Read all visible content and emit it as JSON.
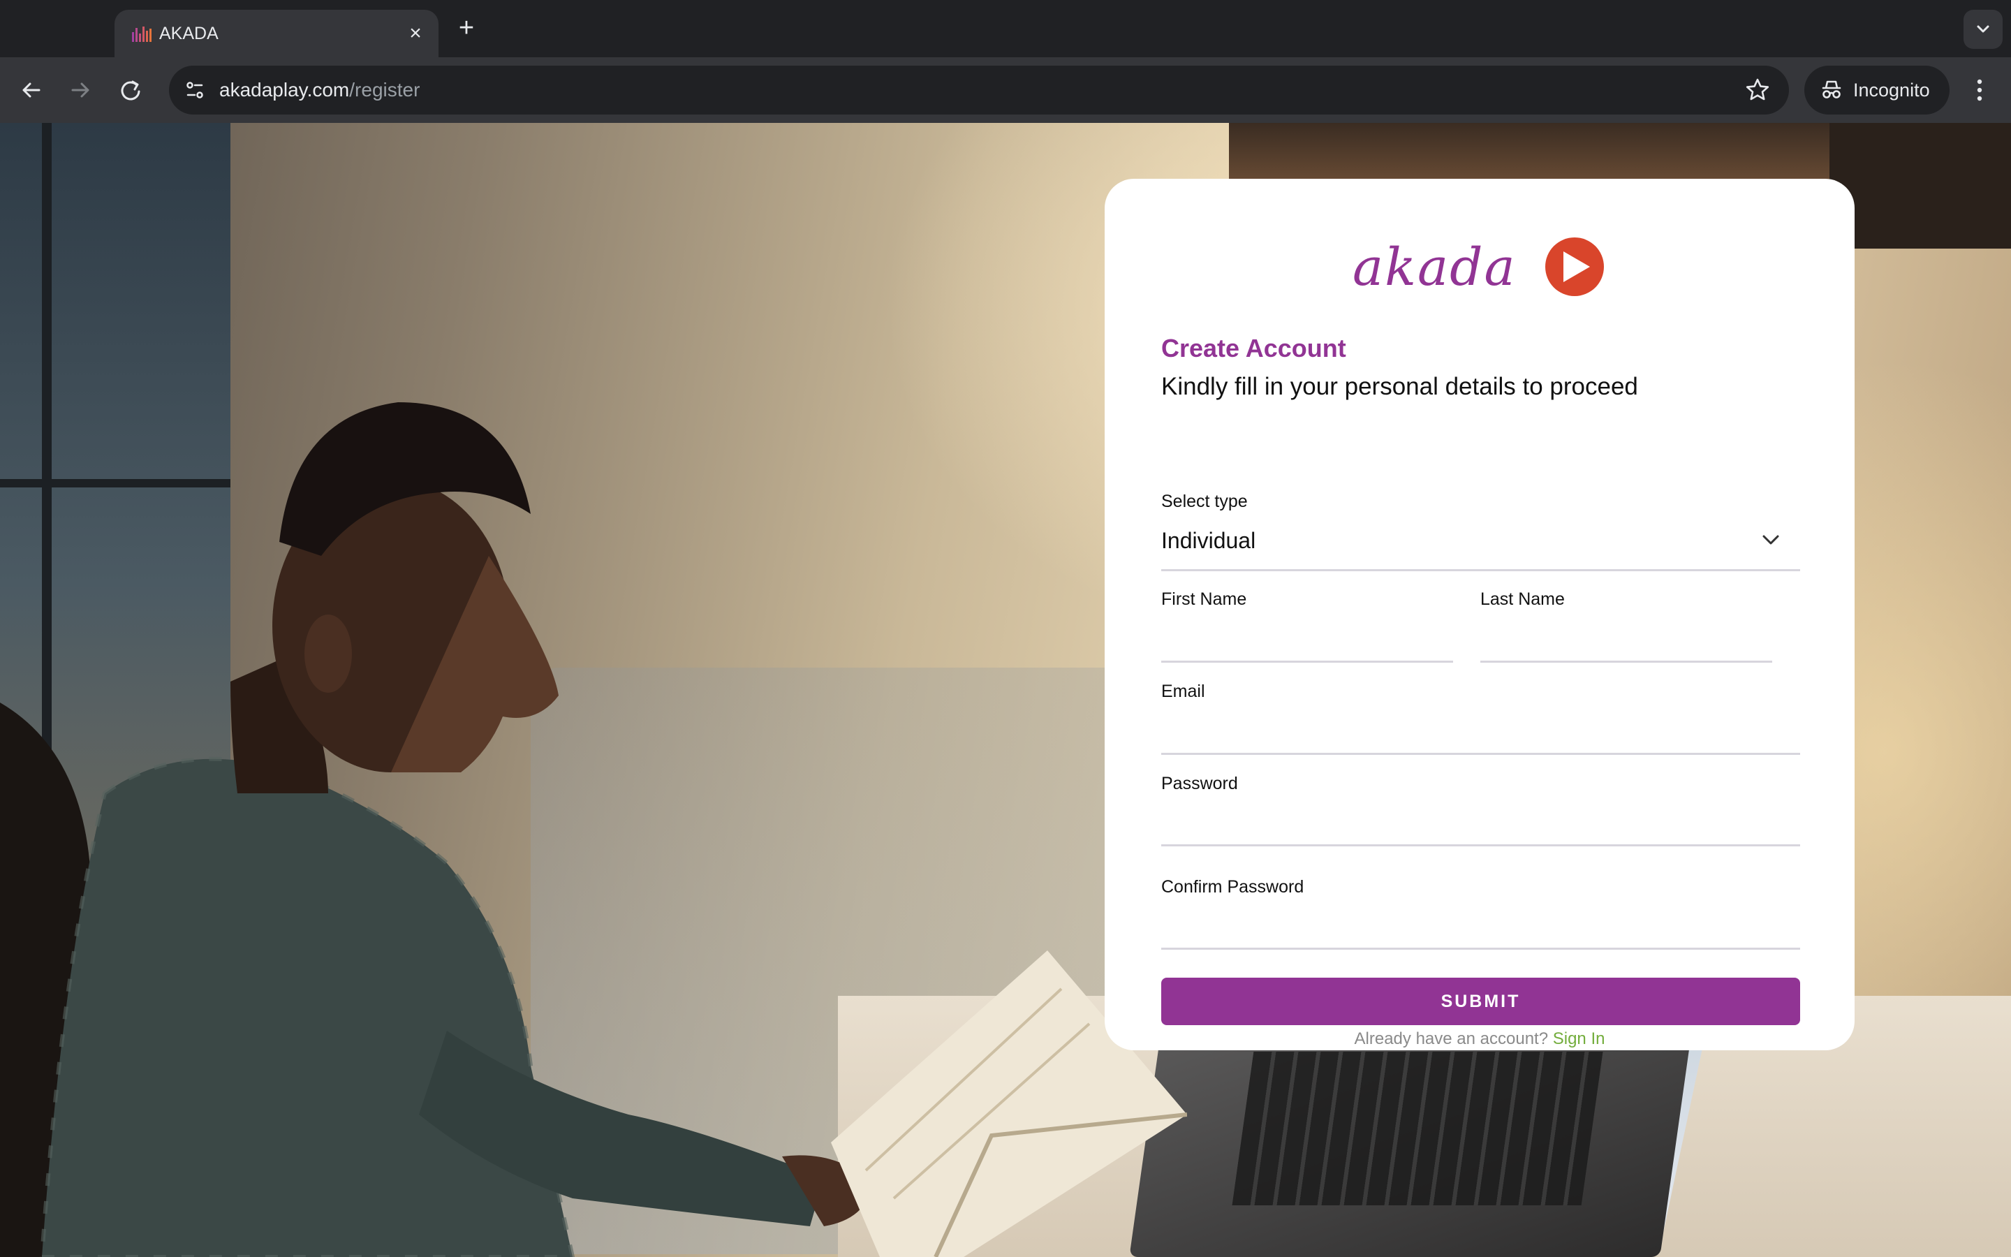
{
  "browser": {
    "tab": {
      "title": "AKADA",
      "favicon": "akada-bars-icon"
    },
    "url": {
      "host": "akadaplay.com",
      "path": "/register"
    },
    "incognito_label": "Incognito",
    "icons": {
      "back": "back-arrow-icon",
      "forward": "forward-arrow-icon",
      "reload": "reload-icon",
      "site_info": "site-info-icon",
      "bookmark": "star-icon",
      "menu": "more-vert-icon",
      "new_tab": "plus-icon",
      "close_tab": "close-icon",
      "tab_search": "chevron-down-icon"
    }
  },
  "form": {
    "title": "Create Account",
    "subtitle": "Kindly fill in your personal details to proceed",
    "select_type": {
      "label": "Select type",
      "value": "Individual"
    },
    "first_name": {
      "label": "First Name",
      "value": ""
    },
    "last_name": {
      "label": "Last Name",
      "value": ""
    },
    "email": {
      "label": "Email",
      "value": ""
    },
    "password": {
      "label": "Password",
      "value": ""
    },
    "confirm_password": {
      "label": "Confirm Password",
      "value": ""
    },
    "submit_label": "SUBMIT",
    "signin_prompt": "Already have an account?",
    "signin_link": "Sign In"
  },
  "colors": {
    "brand_purple": "#913494",
    "brand_orange": "#d9452b",
    "link_green": "#73ad3c",
    "chrome_dark": "#202124",
    "chrome_toolbar": "#35363a"
  }
}
